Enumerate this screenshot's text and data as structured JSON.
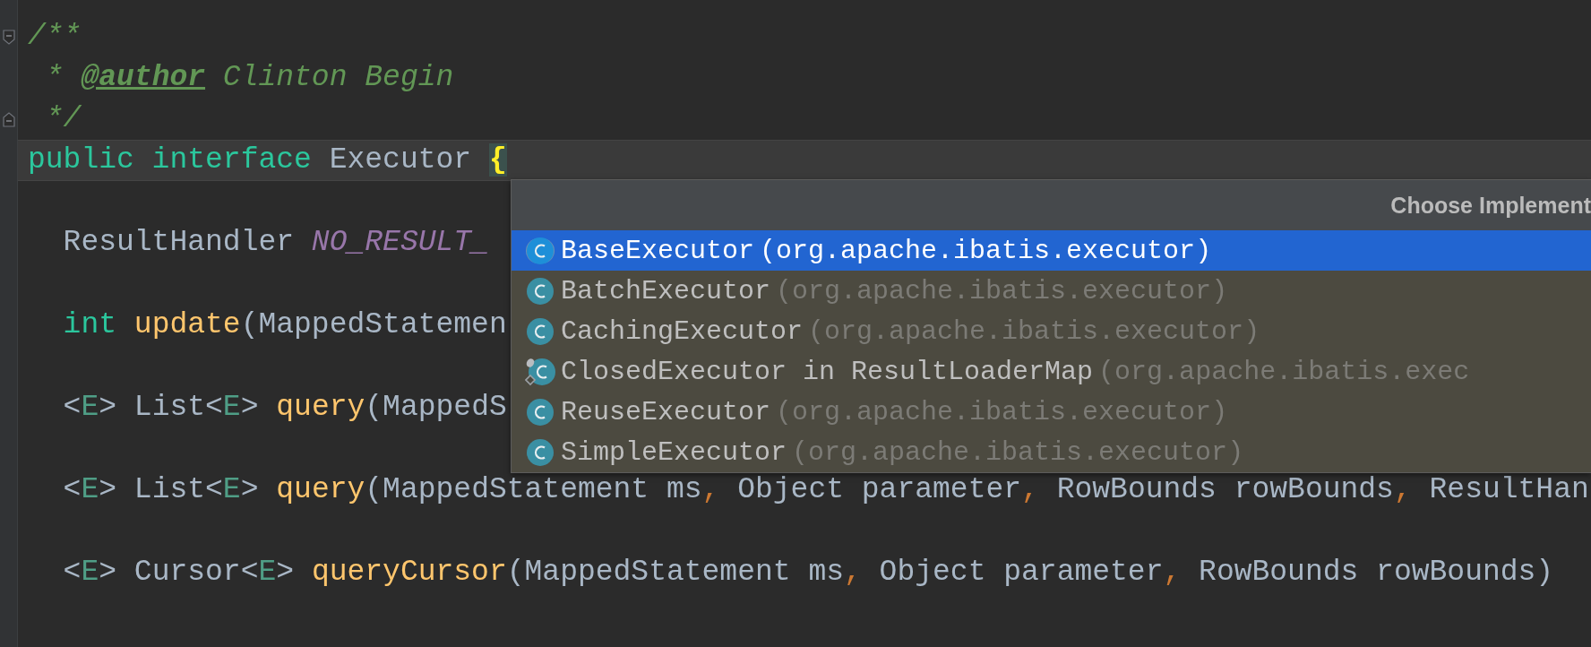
{
  "editor": {
    "lines": [
      {
        "kind": "fold-start",
        "current": false,
        "tokens": [
          {
            "kind": "doc",
            "text": "/**"
          }
        ]
      },
      {
        "kind": "code",
        "current": false,
        "tokens": [
          {
            "kind": "doc",
            "text": " * "
          },
          {
            "kind": "doctag",
            "text": "@author"
          },
          {
            "kind": "doc",
            "text": " Clinton Begin"
          }
        ]
      },
      {
        "kind": "fold-end",
        "current": false,
        "tokens": [
          {
            "kind": "doc",
            "text": " */"
          }
        ]
      },
      {
        "kind": "code",
        "current": true,
        "tokens": [
          {
            "kind": "keyword",
            "text": "public interface"
          },
          {
            "kind": "plain",
            "text": " Executor "
          },
          {
            "kind": "brace",
            "text": "{"
          }
        ]
      },
      {
        "kind": "code",
        "current": false,
        "tokens": [
          {
            "kind": "plain",
            "text": "  ResultHandler "
          },
          {
            "kind": "constant",
            "text": "NO_RESULT_"
          }
        ]
      },
      {
        "kind": "code",
        "current": false,
        "tokens": [
          {
            "kind": "keyword",
            "text": "  int"
          },
          {
            "kind": "method",
            "text": " update"
          },
          {
            "kind": "plain",
            "text": "(MappedStatemen"
          }
        ]
      },
      {
        "kind": "code",
        "current": false,
        "tokens": [
          {
            "kind": "plain",
            "text": "  <"
          },
          {
            "kind": "generic",
            "text": "E"
          },
          {
            "kind": "plain",
            "text": "> List<"
          },
          {
            "kind": "generic",
            "text": "E"
          },
          {
            "kind": "plain",
            "text": "> "
          },
          {
            "kind": "method",
            "text": "query"
          },
          {
            "kind": "plain",
            "text": "(MappedS"
          }
        ]
      },
      {
        "kind": "code",
        "current": false,
        "tokens": [
          {
            "kind": "plain",
            "text": "  <"
          },
          {
            "kind": "generic",
            "text": "E"
          },
          {
            "kind": "plain",
            "text": "> List<"
          },
          {
            "kind": "generic",
            "text": "E"
          },
          {
            "kind": "plain",
            "text": "> "
          },
          {
            "kind": "method",
            "text": "query"
          },
          {
            "kind": "plain",
            "text": "(MappedStatement ms"
          },
          {
            "kind": "comma",
            "text": ","
          },
          {
            "kind": "plain",
            "text": " Object parameter"
          },
          {
            "kind": "comma",
            "text": ","
          },
          {
            "kind": "plain",
            "text": " RowBounds rowBounds"
          },
          {
            "kind": "comma",
            "text": ","
          },
          {
            "kind": "plain",
            "text": " ResultHan"
          }
        ]
      },
      {
        "kind": "code",
        "current": false,
        "tokens": [
          {
            "kind": "plain",
            "text": "  <"
          },
          {
            "kind": "generic",
            "text": "E"
          },
          {
            "kind": "plain",
            "text": "> Cursor<"
          },
          {
            "kind": "generic",
            "text": "E"
          },
          {
            "kind": "plain",
            "text": "> "
          },
          {
            "kind": "method",
            "text": "queryCursor"
          },
          {
            "kind": "plain",
            "text": "(MappedStatement ms"
          },
          {
            "kind": "comma",
            "text": ","
          },
          {
            "kind": "plain",
            "text": " Object parameter"
          },
          {
            "kind": "comma",
            "text": ","
          },
          {
            "kind": "plain",
            "text": " RowBounds rowBounds)"
          }
        ]
      }
    ]
  },
  "popup": {
    "title": "Choose Implement",
    "rows": [
      {
        "kind": "class",
        "name": "BaseExecutor",
        "package": "(org.apache.ibatis.executor)",
        "selected": true
      },
      {
        "kind": "class",
        "name": "BatchExecutor",
        "package": "(org.apache.ibatis.executor)",
        "selected": false
      },
      {
        "kind": "class",
        "name": "CachingExecutor",
        "package": "(org.apache.ibatis.executor)",
        "selected": false
      },
      {
        "kind": "inner-class",
        "name": "ClosedExecutor in ResultLoaderMap",
        "package": "(org.apache.ibatis.exec",
        "selected": false
      },
      {
        "kind": "class",
        "name": "ReuseExecutor",
        "package": "(org.apache.ibatis.executor)",
        "selected": false
      },
      {
        "kind": "class",
        "name": "SimpleExecutor",
        "package": "(org.apache.ibatis.executor)",
        "selected": false
      }
    ]
  }
}
